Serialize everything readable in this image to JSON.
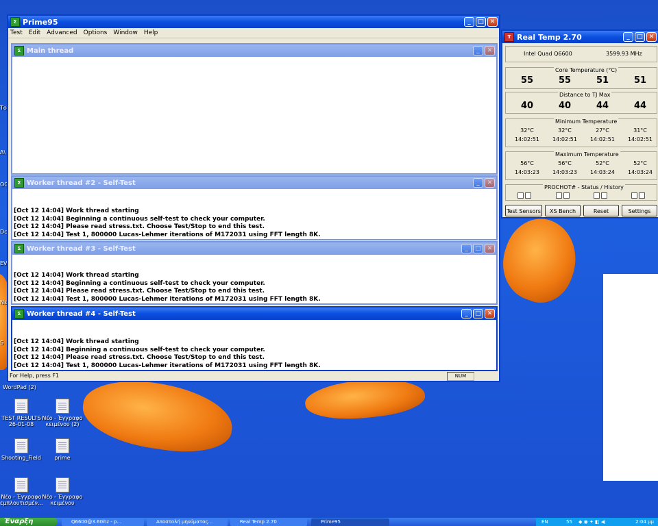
{
  "prime": {
    "title": "Prime95",
    "menu": [
      "Test",
      "Edit",
      "Advanced",
      "Options",
      "Window",
      "Help"
    ],
    "main_thread_title": "Main thread",
    "status_help": "For Help, press F1",
    "status_num": "NUM",
    "workers": [
      {
        "title": "Worker thread #2 - Self-Test",
        "lines": [
          "[Oct 12 14:04] Work thread starting",
          "[Oct 12 14:04] Beginning a continuous self-test to check your computer.",
          "[Oct 12 14:04] Please read stress.txt.  Choose Test/Stop to end this test.",
          "[Oct 12 14:04] Test 1, 800000 Lucas-Lehmer iterations of M172031 using FFT length 8K."
        ]
      },
      {
        "title": "Worker thread #3 - Self-Test",
        "lines": [
          "[Oct 12 14:04] Work thread starting",
          "[Oct 12 14:04] Beginning a continuous self-test to check your computer.",
          "[Oct 12 14:04] Please read stress.txt.  Choose Test/Stop to end this test.",
          "[Oct 12 14:04] Test 1, 800000 Lucas-Lehmer iterations of M172031 using FFT length 8K."
        ]
      },
      {
        "title": "Worker thread #4 - Self-Test",
        "lines": [
          "[Oct 12 14:04] Work thread starting",
          "[Oct 12 14:04] Beginning a continuous self-test to check your computer.",
          "[Oct 12 14:04] Please read stress.txt.  Choose Test/Stop to end this test.",
          "[Oct 12 14:04] Test 1, 800000 Lucas-Lehmer iterations of M172031 using FFT length 8K."
        ]
      }
    ]
  },
  "realtemp": {
    "title": "Real Temp 2.70",
    "cpu": "Intel Quad Q6600",
    "mhz": "3599.93 MHz",
    "core_temp_label": "Core Temperature (°C)",
    "core_temps": [
      "55",
      "55",
      "51",
      "51"
    ],
    "dist_label": "Distance to TJ Max",
    "distances": [
      "40",
      "40",
      "44",
      "44"
    ],
    "min_label": "Minimum Temperature",
    "min_temps": [
      "32°C",
      "32°C",
      "27°C",
      "31°C"
    ],
    "min_times": [
      "14:02:51",
      "14:02:51",
      "14:02:51",
      "14:02:51"
    ],
    "max_label": "Maximum Temperature",
    "max_temps": [
      "56°C",
      "56°C",
      "52°C",
      "52°C"
    ],
    "max_times": [
      "14:03:23",
      "14:03:23",
      "14:03:24",
      "14:03:24"
    ],
    "prochot_label": "PROCHOT#  -  Status / History",
    "buttons": [
      "Test Sensors",
      "XS Bench",
      "Reset",
      "Settings"
    ]
  },
  "desktop_icons": [
    {
      "name": "TEST RESULTS 26-01-08"
    },
    {
      "name": "Νέο - Έγγραφο κειμένου (2)"
    },
    {
      "name": "Shooting_Field"
    },
    {
      "name": "prime"
    },
    {
      "name": "Νέο - Έγγραφο εμπλουτισμέν..."
    },
    {
      "name": "Νέο - Έγγραφο κειμένου"
    }
  ],
  "wordpad_label": "WordPad (2)",
  "taskbar": {
    "start": "Έναρξη",
    "tasks": [
      "Q6600@3.6Ghz - p...",
      "Αποστολή μηνύματος...",
      "Real Temp 2.70",
      "Prime95"
    ],
    "tray_lang": "EN",
    "tray_temps": "55",
    "clock": "2:04 μμ"
  },
  "colors": {
    "title_active": "#0a4fe0",
    "desktop_blue": "#1d5fe0",
    "fish": "#f07a12"
  }
}
